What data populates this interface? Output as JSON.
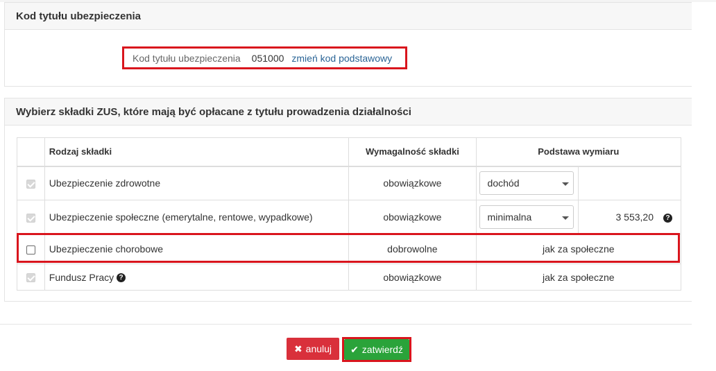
{
  "insurance_code": {
    "title": "Kod tytułu ubezpieczenia",
    "label": "Kod tytułu ubezpieczenia",
    "value": "051000",
    "change_link": "zmień kod podstawowy"
  },
  "contributions": {
    "title": "Wybierz składki ZUS, które mają być opłacane z tytułu prowadzenia działalności",
    "headers": {
      "type": "Rodzaj składki",
      "requirement": "Wymagalność składki",
      "base": "Podstawa wymiaru"
    },
    "rows": [
      {
        "name": "Ubezpieczenie zdrowotne",
        "requirement": "obowiązkowe",
        "checked": true,
        "disabled": true,
        "base_select": "dochód",
        "amount": ""
      },
      {
        "name": "Ubezpieczenie społeczne (emerytalne, rentowe, wypadkowe)",
        "requirement": "obowiązkowe",
        "checked": true,
        "disabled": true,
        "base_select": "minimalna",
        "amount": "3 553,20"
      },
      {
        "name": "Ubezpieczenie chorobowe",
        "requirement": "dobrowolne",
        "checked": false,
        "disabled": false,
        "base_text": "jak za społeczne"
      },
      {
        "name": "Fundusz Pracy",
        "requirement": "obowiązkowe",
        "checked": true,
        "disabled": true,
        "base_text": "jak za społeczne"
      }
    ],
    "help_icon": "?"
  },
  "buttons": {
    "cancel": "anuluj",
    "cancel_icon": "✖",
    "confirm": "zatwierdź",
    "confirm_icon": "✔"
  },
  "colors": {
    "highlight": "#d9151d",
    "cancel": "#d9303b",
    "confirm": "#2aa33a",
    "link": "#2a6496"
  }
}
